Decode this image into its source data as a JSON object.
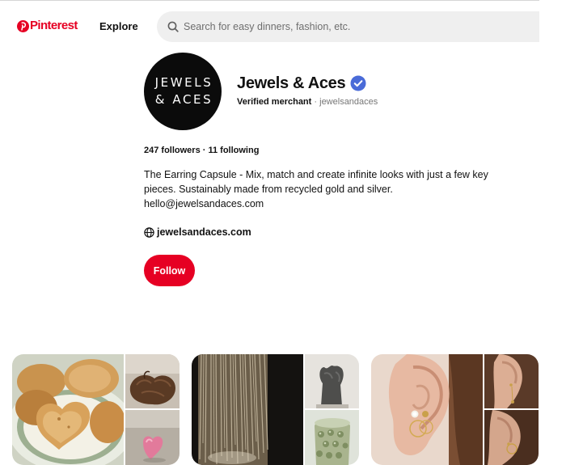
{
  "nav": {
    "logo_text": "Pinterest",
    "explore_label": "Explore",
    "search_placeholder": "Search for easy dinners, fashion, etc."
  },
  "profile": {
    "avatar_text_line1": "JEWELS",
    "avatar_text_line2": "& ACES",
    "name": "Jewels & Aces",
    "verified_label": "Verified merchant",
    "separator": "·",
    "username": "jewelsandaces",
    "stats": "247 followers · 11 following",
    "bio_line1": "The Earring Capsule - Mix, match and create infinite looks with just a few key",
    "bio_line2": "pieces. Sustainably made from recycled gold and silver.",
    "bio_line3": "hello@jewelsandaces.com",
    "website": "jewelsandaces.com",
    "follow_label": "Follow"
  },
  "colors": {
    "brand": "#e60023",
    "verified": "#4a6bd8",
    "search_bg": "#efefef"
  },
  "icons": {
    "logo": "pinterest-p-icon",
    "search": "search-icon",
    "verified": "verified-badge-icon",
    "website": "globe-icon"
  },
  "boards": [
    {
      "images": [
        "pancakes-photo",
        "hair-photo",
        "pink-heart-photo"
      ]
    },
    {
      "images": [
        "sparkle-curtain-photo",
        "stone-sculpture-photo",
        "green-glass-vase-photo"
      ]
    },
    {
      "images": [
        "ear-piercings-photo",
        "ear-chain-photo",
        "ear-hoop-photo"
      ]
    }
  ]
}
